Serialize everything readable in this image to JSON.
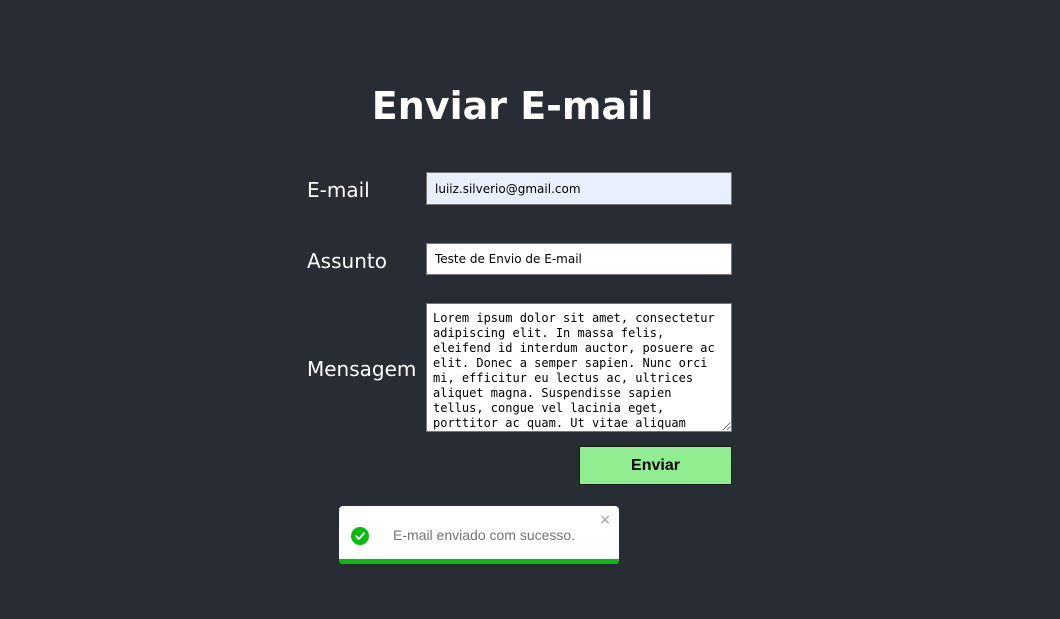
{
  "page": {
    "title": "Enviar E-mail"
  },
  "form": {
    "email_label": "E-mail",
    "email_value": "luiiz.silverio@gmail.com",
    "subject_label": "Assunto",
    "subject_value": "Teste de Envio de E-mail",
    "message_label": "Mensagem",
    "message_value": "Lorem ipsum dolor sit amet, consectetur adipiscing elit. In massa felis, eleifend id interdum auctor, posuere ac elit. Donec a semper sapien. Nunc orci mi, efficitur eu lectus ac, ultrices aliquet magna. Suspendisse sapien tellus, congue vel lacinia eget, porttitor ac quam. Ut vitae aliquam turpis.",
    "submit_label": "Enviar"
  },
  "toast": {
    "message": "E-mail enviado com sucesso.",
    "close_glyph": "×",
    "icon": "check-circle-icon",
    "progress": 1.0
  },
  "colors": {
    "background": "#282c34",
    "submit": "#90ee90",
    "success": "#07bc0c",
    "autofill": "#e8f0fe"
  }
}
